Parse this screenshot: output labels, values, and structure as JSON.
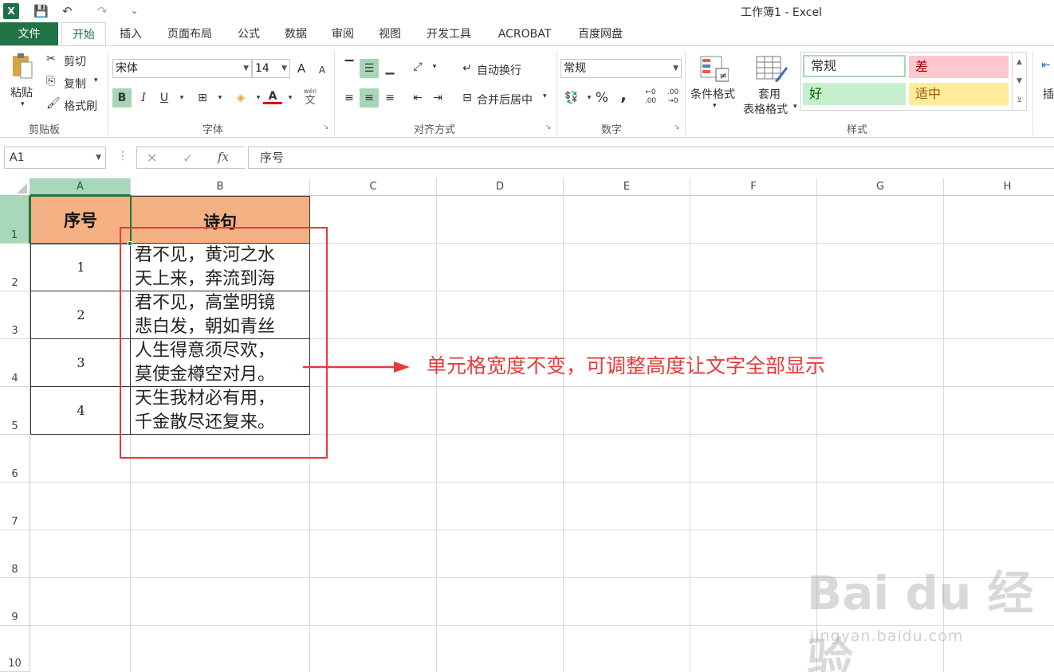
{
  "window": {
    "title": "工作簿1 - Excel",
    "app_icon": "X"
  },
  "quick_access": {
    "save_icon": "💾",
    "undo_icon": "↶",
    "redo_icon": "↷",
    "customize_icon": "⌄"
  },
  "tabs": [
    "文件",
    "开始",
    "插入",
    "页面布局",
    "公式",
    "数据",
    "审阅",
    "视图",
    "开发工具",
    "ACROBAT",
    "百度网盘"
  ],
  "active_tab": "开始",
  "ribbon": {
    "clipboard": {
      "paste": "粘贴",
      "cut": "剪切",
      "copy": "复制",
      "format_painter": "格式刷",
      "label": "剪贴板"
    },
    "font": {
      "name": "宋体",
      "size": "14",
      "bold": "B",
      "italic": "I",
      "underline": "U",
      "font_color_glyph": "A",
      "phonetic_top": "wén",
      "phonetic_bottom": "文",
      "grow": "A",
      "shrink": "A",
      "label": "字体"
    },
    "alignment": {
      "wrap_text": "自动换行",
      "merge_center": "合并后居中",
      "label": "对齐方式"
    },
    "number": {
      "format": "常规",
      "percent": "%",
      "comma": ",",
      "label": "数字"
    },
    "styles": {
      "conditional": "条件格式",
      "table_format_line1": "套用",
      "table_format_line2": "表格格式",
      "normal": "常规",
      "bad": "差",
      "good": "好",
      "neutral": "适中",
      "label": "样式"
    },
    "insert_partial": "插"
  },
  "formula_bar": {
    "name_box": "A1",
    "cancel_icon": "✕",
    "enter_icon": "✓",
    "fx": "fx",
    "content": "序号"
  },
  "columns": [
    "A",
    "B",
    "C",
    "D",
    "E",
    "F",
    "G",
    "H"
  ],
  "rows": [
    "1",
    "2",
    "3",
    "4",
    "5",
    "6",
    "7",
    "8",
    "9",
    "10"
  ],
  "table": {
    "header": [
      "序号",
      "诗句"
    ],
    "rows": [
      {
        "num": "1",
        "line1": "君不见，黄河之水",
        "line2": "天上来，奔流到海"
      },
      {
        "num": "2",
        "line1": "君不见，高堂明镜",
        "line2": "悲白发，朝如青丝"
      },
      {
        "num": "3",
        "line1": "人生得意须尽欢，",
        "line2": "莫使金樽空对月。"
      },
      {
        "num": "4",
        "line1": "天生我材必有用，",
        "line2": "千金散尽还复来。"
      }
    ]
  },
  "annotation": {
    "text": "单元格宽度不变，可调整高度让文字全部显示"
  },
  "watermark": {
    "brand": "Bai du 经验",
    "url": "jingyan.baidu.com"
  },
  "colors": {
    "excel_green": "#217346",
    "header_fill": "#f4b183",
    "annotation_red": "#e83a3a"
  }
}
